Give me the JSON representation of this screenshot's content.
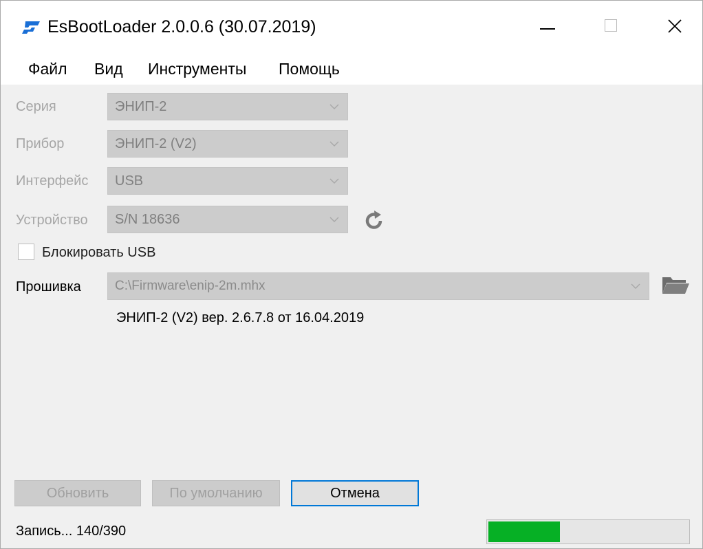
{
  "window": {
    "title": "EsBootLoader 2.0.0.6 (30.07.2019)",
    "app_icon": "esbootloader-logo-icon",
    "controls": [
      "minimize-icon",
      "maximize-icon",
      "close-icon"
    ]
  },
  "menu": {
    "file": "Файл",
    "view": "Вид",
    "tools": "Инструменты",
    "help": "Помощь"
  },
  "form": {
    "series": {
      "label": "Серия",
      "value": "ЭНИП-2"
    },
    "device_model": {
      "label": "Прибор",
      "value": "ЭНИП-2 (V2)"
    },
    "interface": {
      "label": "Интерфейс",
      "value": "USB"
    },
    "device": {
      "label": "Устройство",
      "value": "S/N 18636"
    },
    "block_usb": {
      "label": "Блокировать USB",
      "checked": false
    },
    "firmware": {
      "label": "Прошивка",
      "path": "C:\\Firmware\\enip-2m.mhx",
      "info": "ЭНИП-2 (V2) вер. 2.6.7.8 от 16.04.2019"
    }
  },
  "buttons": {
    "update": "Обновить",
    "defaults": "По умолчанию",
    "cancel": "Отмена"
  },
  "status": {
    "text": "Запись... 140/390",
    "progress_current": 140,
    "progress_total": 390,
    "progress_color": "#06b025"
  }
}
